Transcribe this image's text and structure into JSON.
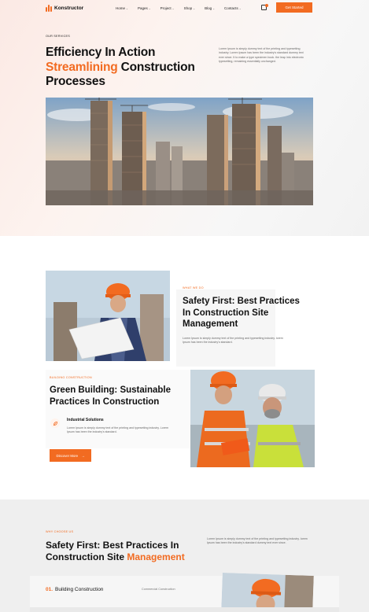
{
  "brand": {
    "name": "Konstructor"
  },
  "nav": {
    "items": [
      {
        "label": "Home"
      },
      {
        "label": "Pages"
      },
      {
        "label": "Project"
      },
      {
        "label": "Shop"
      },
      {
        "label": "Blog"
      },
      {
        "label": "Contacts"
      }
    ],
    "cta_label": "Get Started"
  },
  "hero": {
    "eyebrow": "OUR SERVICES",
    "title_line1": "Efficiency In Action",
    "title_accent": "Streamlining",
    "title_line2_rest": " Construction",
    "title_line3": "Processes",
    "description": "Lorem Ipsum is simply dummy text of the printing and typesetting industry. Lorem Ipsum has been the industry's standard dummy text ever since. It to make a type specimen book. the leap into electronic typesetting, remaining essentially unchanged."
  },
  "what_we_do": {
    "eyebrow": "WHAT WE DO",
    "title": "Safety First: Best Practices In Construction Site Management",
    "description": "Lorem Ipsum is simply dummy text of the printing and typesetting industry. lorem Ipsum has been the industry's standard."
  },
  "building": {
    "eyebrow": "BUILDING CONSTRUCTION",
    "title": "Green Building: Sustainable Practices In Construction",
    "feature_title": "Industrial Solutions",
    "feature_desc": "Lorem Ipsum is simply dummy text of the printing and typesetting industry. Lorem Ipsum has been the industry's standard.",
    "button_label": "Discover More"
  },
  "why": {
    "eyebrow": "WHY CHOOSE US",
    "title_main": "Safety First: Best Practices In Construction Site ",
    "title_accent": "Management",
    "description": "Lorem Ipsum is simply dummy text of the printing and typesetting industry. lorem Ipsum has been the industry's standard dummy text ever since."
  },
  "services": [
    {
      "num": "01.",
      "title": "Building Construction",
      "subtitle": "Commercial Construction"
    }
  ],
  "colors": {
    "accent": "#f26b21",
    "text": "#111111",
    "muted": "#666666"
  },
  "icons": [
    "logo-icon",
    "cart-icon",
    "chevron-down-icon",
    "eco-icon",
    "arrow-right-icon"
  ]
}
